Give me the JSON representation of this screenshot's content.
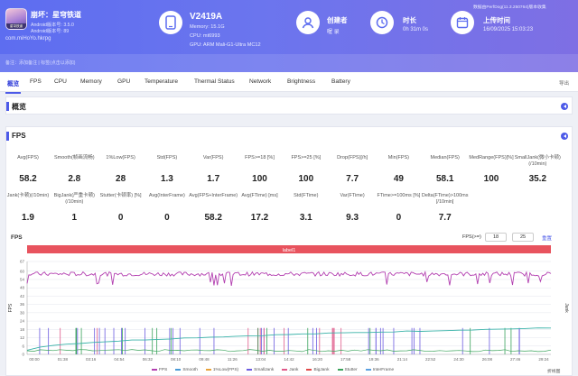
{
  "app": {
    "name": "崩坏：星穹铁道",
    "icon_tag": "星穹铁道",
    "target_sdk": "Android版本号: 3.5.0",
    "min_sdk": "Android版本号: 89",
    "package": "com.miHoYo.hkrpg"
  },
  "subbar_text": "备注：添加备注    |    标签(点击以添加)",
  "device": {
    "name": "V2419A",
    "memory": "Memory: 15.1G",
    "cpu": "CPU: mt6993",
    "gpu": "GPU: ARM Mali-G1-Ultra MC12"
  },
  "stats": [
    {
      "label": "创建者",
      "value": "喔 录"
    },
    {
      "label": "时长",
      "value": "0h 31m 0s"
    },
    {
      "label": "上传时间",
      "value": "16/09/2025 15:03:23"
    }
  ],
  "corner_text": "数据由PerfDog(11.3.250764)版本收集",
  "tabs": [
    "概览",
    "FPS",
    "CPU",
    "Memory",
    "GPU",
    "Temperature",
    "Thermal Status",
    "Network",
    "Brightness",
    "Battery"
  ],
  "active_tab": "概览",
  "tabs_right": "导出",
  "sections": {
    "overview": "概览",
    "fps": "FPS"
  },
  "metrics_row1": [
    {
      "label": "Avg(FPS)",
      "value": "58.2"
    },
    {
      "label": "Smooth(帧画流畅)",
      "value": "2.8"
    },
    {
      "label": "1%Low(FPS)",
      "value": "28"
    },
    {
      "label": "Std(FPS)",
      "value": "1.3"
    },
    {
      "label": "Var(FPS)",
      "value": "1.7"
    },
    {
      "label": "FPS>=18 [%]",
      "value": "100"
    },
    {
      "label": "FPS>=25 [%]",
      "value": "100"
    },
    {
      "label": "Drop(FPS)[/h]",
      "value": "7.7"
    },
    {
      "label": "Min(FPS)",
      "value": "49"
    },
    {
      "label": "Median(FPS)",
      "value": "58.1"
    },
    {
      "label": "MedRange(FPS)[%]",
      "value": "100"
    },
    {
      "label": "SmallJank(微小卡顿)(/10min)",
      "value": "35.2"
    }
  ],
  "metrics_row2": [
    {
      "label": "Jank(卡顿)(/10min)",
      "value": "1.9"
    },
    {
      "label": "BigJank(严重卡顿)(/10min)",
      "value": "1"
    },
    {
      "label": "Stutter(卡顿率) [%]",
      "value": "0"
    },
    {
      "label": "Avg(InterFrame)",
      "value": "0"
    },
    {
      "label": "Avg(FPS+InterFrame)",
      "value": "58.2"
    },
    {
      "label": "Avg(FTime) [ms]",
      "value": "17.2"
    },
    {
      "label": "Std(FTime)",
      "value": "3.1"
    },
    {
      "label": "Var(FTime)",
      "value": "9.3"
    },
    {
      "label": "FTime>=100ms [%]",
      "value": "0"
    },
    {
      "label": "Delta(FTime)>100ms [/10min]",
      "value": "7.7"
    }
  ],
  "chart_controls": {
    "title": "FPS",
    "range_label": "FPS(>=)",
    "range_low": "18",
    "range_high": "25",
    "reset": "重置"
  },
  "chart_data": {
    "type": "line",
    "label_band": "label1",
    "ylabel": "FPS",
    "y2label": "Jank",
    "yticks": [
      0,
      6,
      12,
      18,
      24,
      30,
      36,
      42,
      48,
      54,
      60,
      67
    ],
    "ylim": [
      0,
      67
    ],
    "xticks": [
      "00:00",
      "01:38",
      "03:16",
      "04:54",
      "06:32",
      "08:10",
      "09:48",
      "11:26",
      "13:04",
      "14:42",
      "16:20",
      "17:58",
      "19:36",
      "21:14",
      "22:52",
      "24:30",
      "26:08",
      "27:46",
      "29:24"
    ],
    "grid": true,
    "legend_position": "bottom",
    "series": [
      {
        "name": "FPS",
        "color": "#b23fb0",
        "mean": 58.2,
        "min": 49,
        "max": 60
      },
      {
        "name": "Smooth",
        "color": "#4a9ad6"
      },
      {
        "name": "1%Low(FPS)",
        "color": "#e8a33c"
      },
      {
        "name": "SmallJank",
        "color": "#6c5ce0"
      },
      {
        "name": "Jank",
        "color": "#e05a8a"
      },
      {
        "name": "BigJank",
        "color": "#e04a4a"
      },
      {
        "name": "Stutter",
        "color": "#3aa35b"
      },
      {
        "name": "InterFrame",
        "color": "#5aa0e0"
      }
    ],
    "legend_right": "折线图"
  }
}
